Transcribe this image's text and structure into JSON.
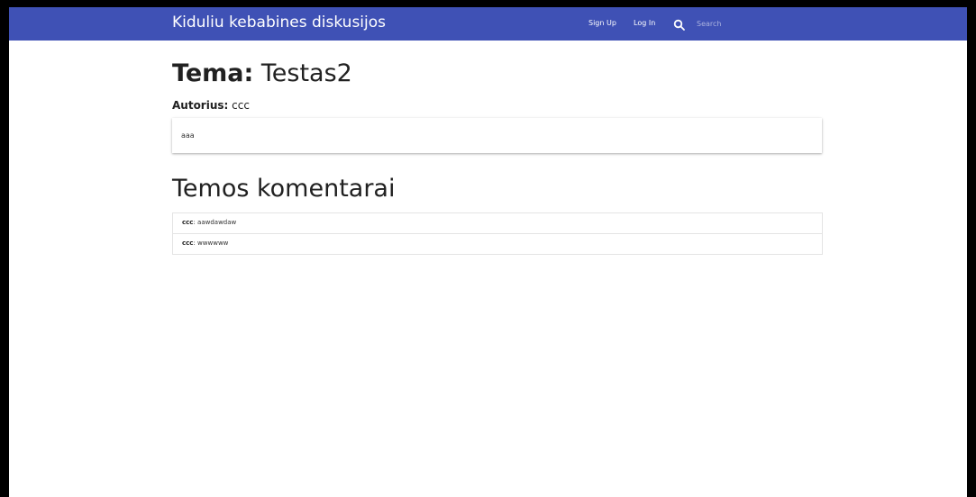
{
  "navbar": {
    "brand": "Kiduliu kebabines diskusijos",
    "signup_label": "Sign Up",
    "login_label": "Log In",
    "search_placeholder": "Search",
    "background_color": "#3f51b5"
  },
  "topic": {
    "title_label": "Tema:",
    "title": "Testas2",
    "author_label": "Autorius:",
    "author": "ccc",
    "body": "aaa"
  },
  "comments": {
    "heading": "Temos komentarai",
    "items": [
      {
        "author": "ccc",
        "text": "aawdawdaw"
      },
      {
        "author": "ccc",
        "text": "wwwwww"
      }
    ]
  }
}
